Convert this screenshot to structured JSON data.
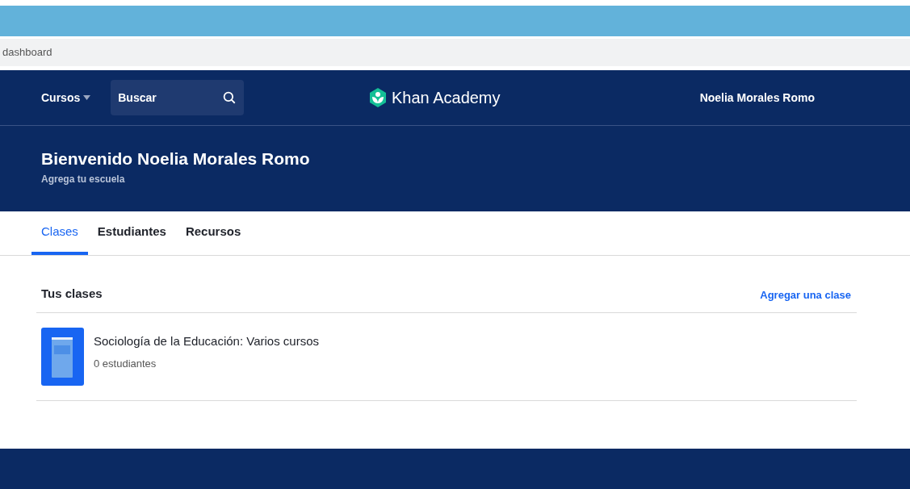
{
  "address_bar": {
    "url": "dashboard"
  },
  "nav": {
    "courses_menu": "Cursos",
    "search": {
      "placeholder": "Buscar"
    },
    "logo": "Khan Academy",
    "user": "Noelia Morales Romo"
  },
  "hero": {
    "title": "Bienvenido Noelia Morales Romo",
    "subtitle": "Agrega tu escuela"
  },
  "tabs": [
    {
      "label": "Clases",
      "selected": true
    },
    {
      "label": "Estudiantes",
      "selected": false
    },
    {
      "label": "Recursos",
      "selected": false
    }
  ],
  "classes": {
    "heading": "Tus clases",
    "add_link": "Agregar una clase",
    "items": [
      {
        "name": "Sociología de la Educación: Varios cursos",
        "students": "0 estudiantes"
      }
    ]
  }
}
